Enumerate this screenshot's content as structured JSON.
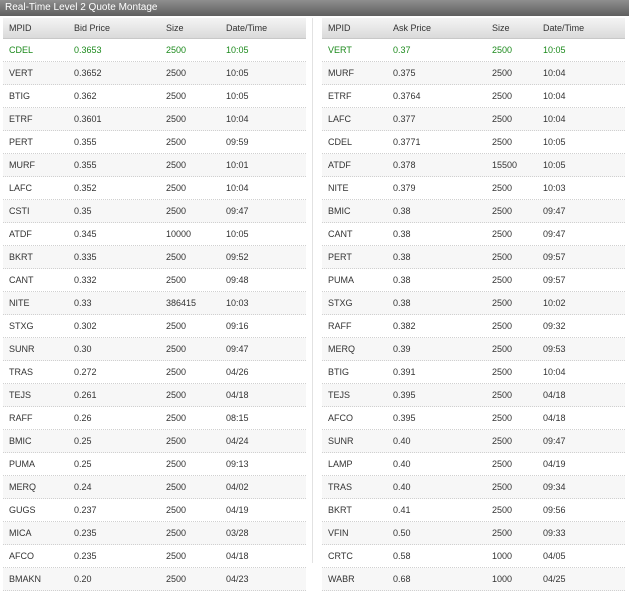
{
  "title": "Real-Time Level 2 Quote Montage",
  "bid": {
    "headers": [
      "MPID",
      "Bid Price",
      "Size",
      "Date/Time"
    ],
    "rows": [
      [
        "CDEL",
        "0.3653",
        "2500",
        "10:05"
      ],
      [
        "VERT",
        "0.3652",
        "2500",
        "10:05"
      ],
      [
        "BTIG",
        "0.362",
        "2500",
        "10:05"
      ],
      [
        "ETRF",
        "0.3601",
        "2500",
        "10:04"
      ],
      [
        "PERT",
        "0.355",
        "2500",
        "09:59"
      ],
      [
        "MURF",
        "0.355",
        "2500",
        "10:01"
      ],
      [
        "LAFC",
        "0.352",
        "2500",
        "10:04"
      ],
      [
        "CSTI",
        "0.35",
        "2500",
        "09:47"
      ],
      [
        "ATDF",
        "0.345",
        "10000",
        "10:05"
      ],
      [
        "BKRT",
        "0.335",
        "2500",
        "09:52"
      ],
      [
        "CANT",
        "0.332",
        "2500",
        "09:48"
      ],
      [
        "NITE",
        "0.33",
        "386415",
        "10:03"
      ],
      [
        "STXG",
        "0.302",
        "2500",
        "09:16"
      ],
      [
        "SUNR",
        "0.30",
        "2500",
        "09:47"
      ],
      [
        "TRAS",
        "0.272",
        "2500",
        "04/26"
      ],
      [
        "TEJS",
        "0.261",
        "2500",
        "04/18"
      ],
      [
        "RAFF",
        "0.26",
        "2500",
        "08:15"
      ],
      [
        "BMIC",
        "0.25",
        "2500",
        "04/24"
      ],
      [
        "PUMA",
        "0.25",
        "2500",
        "09:13"
      ],
      [
        "MERQ",
        "0.24",
        "2500",
        "04/02"
      ],
      [
        "GUGS",
        "0.237",
        "2500",
        "04/19"
      ],
      [
        "MICA",
        "0.235",
        "2500",
        "03/28"
      ],
      [
        "AFCO",
        "0.235",
        "2500",
        "04/18"
      ],
      [
        "BMAKN",
        "0.20",
        "2500",
        "04/23"
      ]
    ]
  },
  "ask": {
    "headers": [
      "MPID",
      "Ask Price",
      "Size",
      "Date/Time"
    ],
    "rows": [
      [
        "VERT",
        "0.37",
        "2500",
        "10:05"
      ],
      [
        "MURF",
        "0.375",
        "2500",
        "10:04"
      ],
      [
        "ETRF",
        "0.3764",
        "2500",
        "10:04"
      ],
      [
        "LAFC",
        "0.377",
        "2500",
        "10:04"
      ],
      [
        "CDEL",
        "0.3771",
        "2500",
        "10:05"
      ],
      [
        "ATDF",
        "0.378",
        "15500",
        "10:05"
      ],
      [
        "NITE",
        "0.379",
        "2500",
        "10:03"
      ],
      [
        "BMIC",
        "0.38",
        "2500",
        "09:47"
      ],
      [
        "CANT",
        "0.38",
        "2500",
        "09:47"
      ],
      [
        "PERT",
        "0.38",
        "2500",
        "09:57"
      ],
      [
        "PUMA",
        "0.38",
        "2500",
        "09:57"
      ],
      [
        "STXG",
        "0.38",
        "2500",
        "10:02"
      ],
      [
        "RAFF",
        "0.382",
        "2500",
        "09:32"
      ],
      [
        "MERQ",
        "0.39",
        "2500",
        "09:53"
      ],
      [
        "BTIG",
        "0.391",
        "2500",
        "10:04"
      ],
      [
        "TEJS",
        "0.395",
        "2500",
        "04/18"
      ],
      [
        "AFCO",
        "0.395",
        "2500",
        "04/18"
      ],
      [
        "SUNR",
        "0.40",
        "2500",
        "09:47"
      ],
      [
        "LAMP",
        "0.40",
        "2500",
        "04/19"
      ],
      [
        "TRAS",
        "0.40",
        "2500",
        "09:34"
      ],
      [
        "BKRT",
        "0.41",
        "2500",
        "09:56"
      ],
      [
        "VFIN",
        "0.50",
        "2500",
        "09:33"
      ],
      [
        "CRTC",
        "0.58",
        "1000",
        "04/05"
      ],
      [
        "WABR",
        "0.68",
        "1000",
        "04/25"
      ]
    ]
  },
  "colors": {
    "best_quote": "#1c8a1c",
    "title_bar": "#6e6e6e"
  }
}
